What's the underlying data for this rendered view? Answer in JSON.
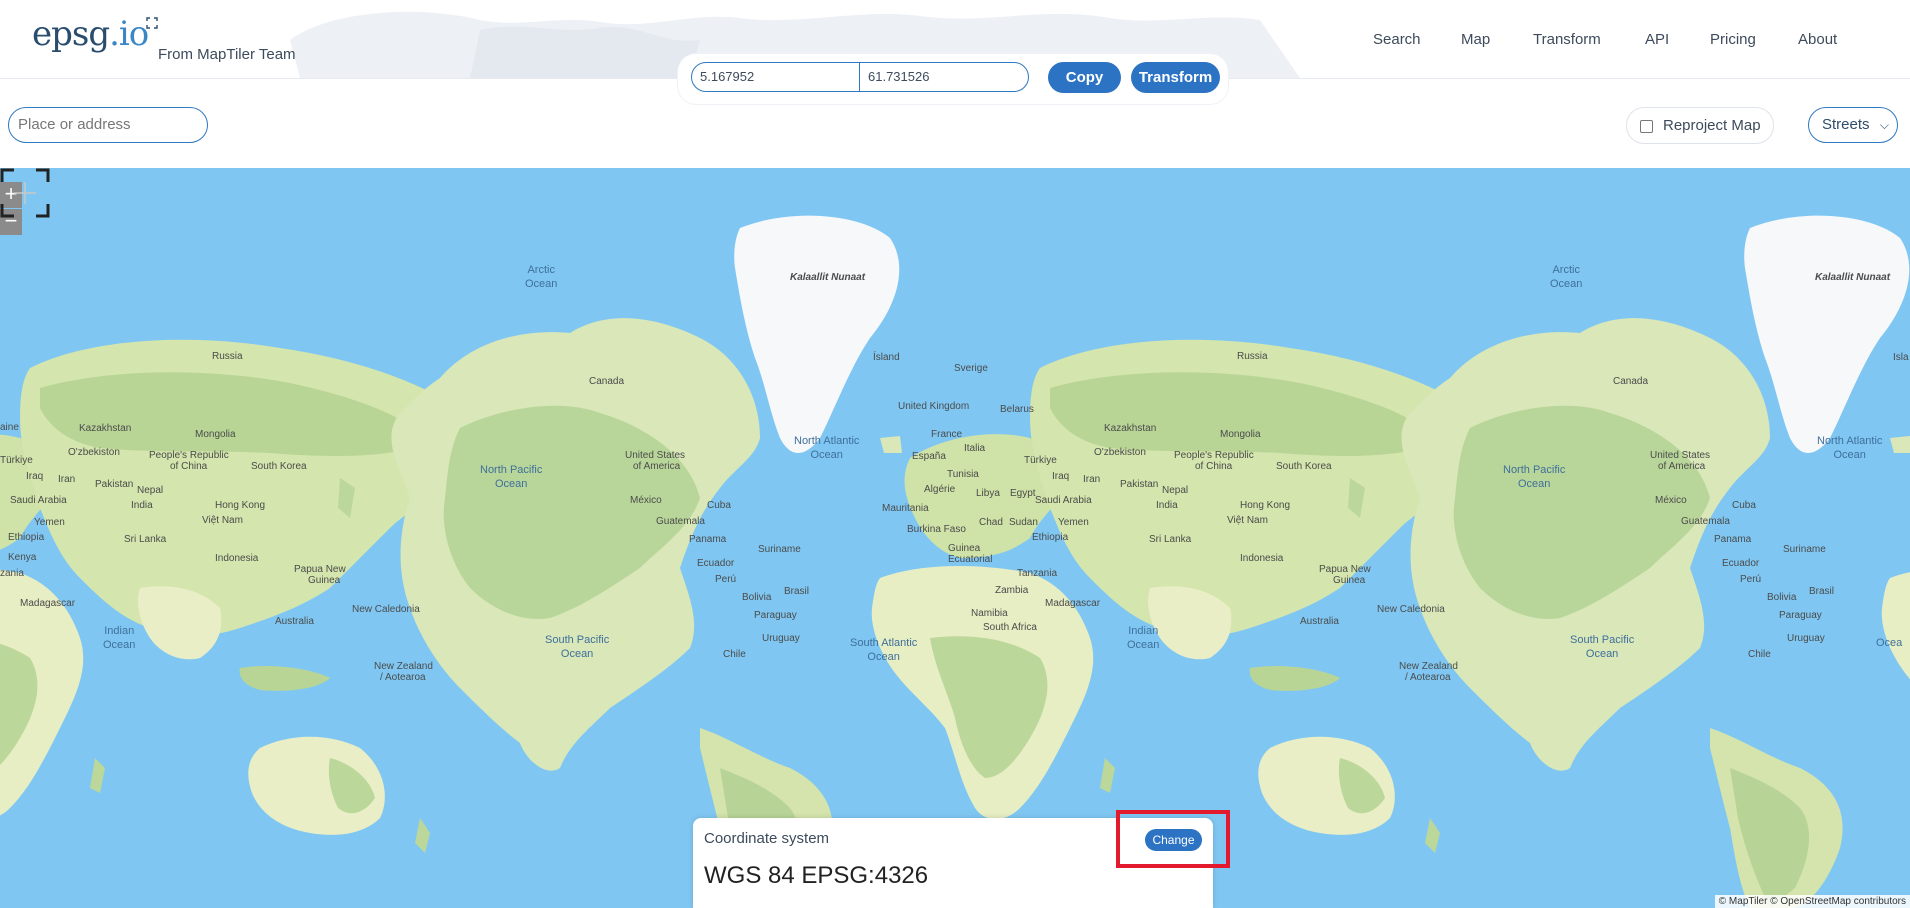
{
  "brand": {
    "logo_main": "epsg",
    "logo_dot": ".io",
    "subtitle": "From MapTiler Team"
  },
  "nav": [
    {
      "label": "Search"
    },
    {
      "label": "Map"
    },
    {
      "label": "Transform"
    },
    {
      "label": "API"
    },
    {
      "label": "Pricing"
    },
    {
      "label": "About"
    }
  ],
  "coords": {
    "x": "5.167952",
    "y": "61.731526"
  },
  "actions": {
    "copy": "Copy",
    "transform": "Transform"
  },
  "search": {
    "placeholder": "Place or address"
  },
  "reproject": {
    "label": "Reproject Map",
    "checked": false
  },
  "map_style": {
    "selected": "Streets"
  },
  "zoom": {
    "in": "+",
    "out": "−"
  },
  "map": {
    "labels": {
      "greenland_left": "Kalaallit Nunaat",
      "greenland_right": "Kalaallit Nunaat",
      "island": "Ísland",
      "russia_left": "Russia",
      "russia_right": "Russia",
      "canada_left": "Canada",
      "canada_right": "Canada",
      "kazakhstan_left": "Kazakhstan",
      "kazakhstan_right": "Kazakhstan",
      "mongolia_left": "Mongolia",
      "mongolia_right": "Mongolia",
      "china_left_1": "People's Republic",
      "china_left_2": "of China",
      "china_right_1": "People's Republic",
      "china_right_2": "of China",
      "usa_left_1": "United States",
      "usa_left_2": "of America",
      "usa_right_1": "United States",
      "usa_right_2": "of America",
      "uk": "United Kingdom",
      "sverige": "Sverige",
      "belarus": "Belarus",
      "france": "France",
      "italia": "Italia",
      "espana": "España",
      "tunisia": "Tunisia",
      "algerie": "Algérie",
      "libya": "Libya",
      "egypt": "Egypt",
      "mauritania": "Mauritania",
      "burkina": "Burkina Faso",
      "chad": "Chad",
      "sudan": "Sudan",
      "ethiopia_mid": "Ethiopia",
      "guinea_1": "Guinea",
      "guinea_2": "Ecuatorial",
      "tanzania": "Tanzania",
      "zambia": "Zambia",
      "namibia": "Namibia",
      "south_africa": "South Africa",
      "madagascar_mid": "Madagascar",
      "turkiye_left": "Türkiye",
      "turkiye_mid": "Türkiye",
      "iraq_left": "Iraq",
      "iraq_mid": "Iraq",
      "iran_left": "Iran",
      "iran_mid": "Iran",
      "saudi_left": "Saudi Arabia",
      "saudi_mid": "Saudi Arabia",
      "yemen_left": "Yemen",
      "yemen_mid": "Yemen",
      "uzbekistan_left": "O'zbekiston",
      "uzbekistan_right": "O'zbekiston",
      "pakistan_left": "Pakistan",
      "pakistan_right": "Pakistan",
      "nepal_left": "Nepal",
      "nepal_right": "Nepal",
      "india_left": "India",
      "india_right": "India",
      "srilanka_left": "Sri Lanka",
      "srilanka_right": "Sri Lanka",
      "vietnam_left": "Việt Nam",
      "vietnam_right": "Việt Nam",
      "hongkong_left": "Hong Kong",
      "hongkong_right": "Hong Kong",
      "southkorea_left": "South Korea",
      "southkorea_right": "South Korea",
      "indonesia_left": "Indonesia",
      "indonesia_right": "Indonesia",
      "png_left_1": "Papua New",
      "png_left_2": "Guinea",
      "png_right_1": "Papua New",
      "png_right_2": "Guinea",
      "australia_left": "Australia",
      "australia_right": "Australia",
      "newcal_left": "New Caledonia",
      "newcal_right": "New Caledonia",
      "nz_left_1": "New Zealand",
      "nz_left_2": "/ Aotearoa",
      "nz_right_1": "New Zealand",
      "nz_right_2": "/ Aotearoa",
      "mexico_left": "México",
      "mexico_right": "México",
      "cuba_left": "Cuba",
      "cuba_right": "Cuba",
      "guatemala_left": "Guatemala",
      "guatemala_right": "Guatemala",
      "panama_left": "Panama",
      "panama_right": "Panama",
      "suriname_left": "Suriname",
      "suriname_right": "Suriname",
      "ecuador_left": "Ecuador",
      "ecuador_right": "Ecuador",
      "peru_left": "Perú",
      "peru_right": "Perú",
      "brasil_left": "Brasil",
      "brasil_right": "Brasil",
      "bolivia_left": "Bolivia",
      "bolivia_right": "Bolivia",
      "paraguay_left": "Paraguay",
      "paraguay_right": "Paraguay",
      "uruguay_left": "Uruguay",
      "uruguay_right": "Uruguay",
      "chile_left": "Chile",
      "chile_right": "Chile",
      "ethiopia_far": "Ethiopia",
      "kenya_far": "Kenya",
      "madagascar_far": "Madagascar",
      "saudi_far": "Saudi Arabia",
      "yemen_far": "Yemen",
      "turkiye_far": "Türkiye",
      "iraq_far": "Iraq",
      "iran_far": "Iran",
      "isla_far": "Isla",
      "tanzania_far": "zania",
      "aine_far": "aine"
    },
    "oceans": {
      "arctic_left_1": "Arctic",
      "arctic_left_2": "Ocean",
      "arctic_right_1": "Arctic",
      "arctic_right_2": "Ocean",
      "natl_left_1": "North Atlantic",
      "natl_left_2": "Ocean",
      "natl_right_1": "North Atlantic",
      "natl_right_2": "Ocean",
      "npac_left_1": "North Pacific",
      "npac_left_2": "Ocean",
      "npac_right_1": "North Pacific",
      "npac_right_2": "Ocean",
      "indian_left_1": "Indian",
      "indian_left_2": "Ocean",
      "indian_right_1": "Indian",
      "indian_right_2": "Ocean",
      "spac_left_1": "South Pacific",
      "spac_left_2": "Ocean",
      "spac_right_1": "South Pacific",
      "spac_right_2": "Ocean",
      "satl_1": "South Atlantic",
      "satl_2": "Ocean",
      "far_right": "Ocea"
    }
  },
  "crs": {
    "label": "Coordinate system",
    "name": "WGS 84 EPSG:4326",
    "change": "Change"
  },
  "attribution": "© MapTiler © OpenStreetMap contributors"
}
